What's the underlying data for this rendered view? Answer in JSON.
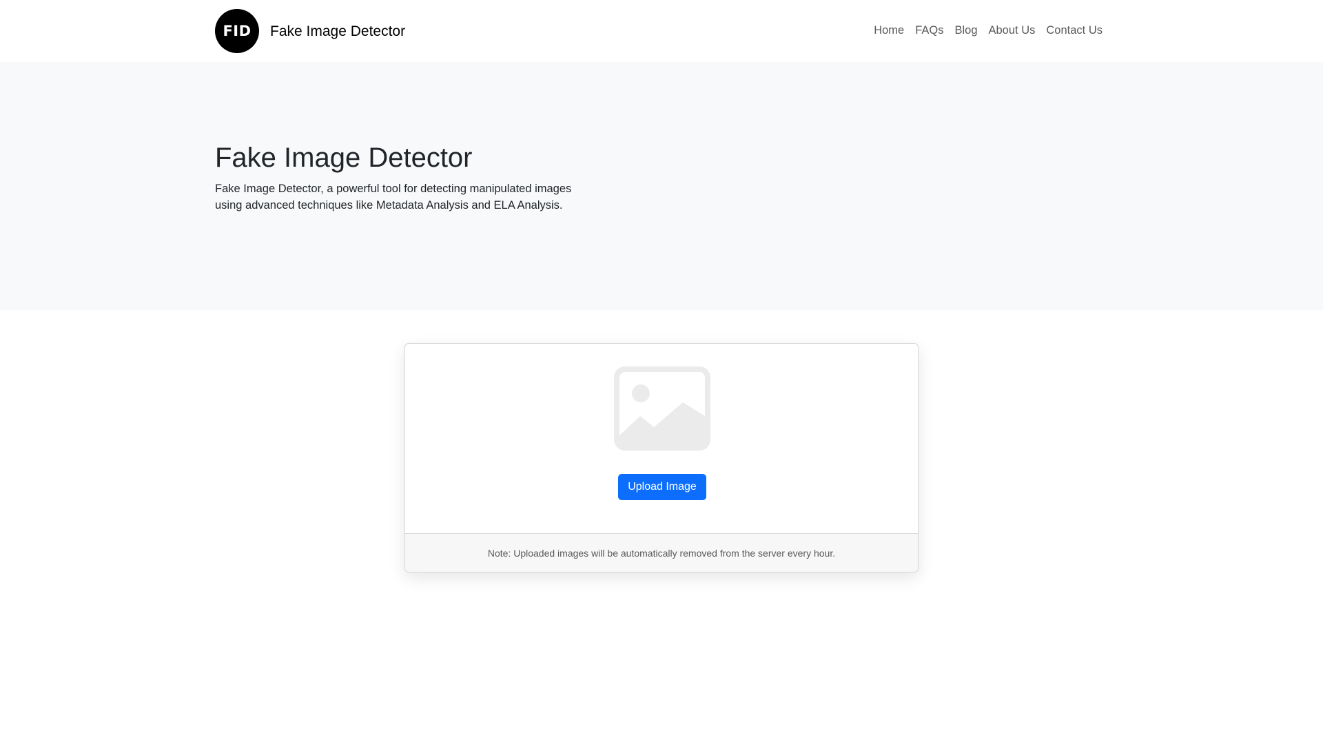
{
  "brand": {
    "logo_text": "FID",
    "name": "Fake Image Detector"
  },
  "nav": {
    "items": [
      {
        "label": "Home"
      },
      {
        "label": "FAQs"
      },
      {
        "label": "Blog"
      },
      {
        "label": "About Us"
      },
      {
        "label": "Contact Us"
      }
    ]
  },
  "hero": {
    "title": "Fake Image Detector",
    "description": "Fake Image Detector, a powerful tool for detecting manipulated images using advanced techniques like Metadata Analysis and ELA Analysis."
  },
  "upload": {
    "placeholder_icon": "image-placeholder-icon",
    "button_label": "Upload Image",
    "note": "Note: Uploaded images will be automatically removed from the server every hour."
  },
  "colors": {
    "primary": "#0d6efd",
    "hero_background": "#f8f9fa",
    "logo_background": "#000000",
    "placeholder_icon": "#ebebeb"
  }
}
